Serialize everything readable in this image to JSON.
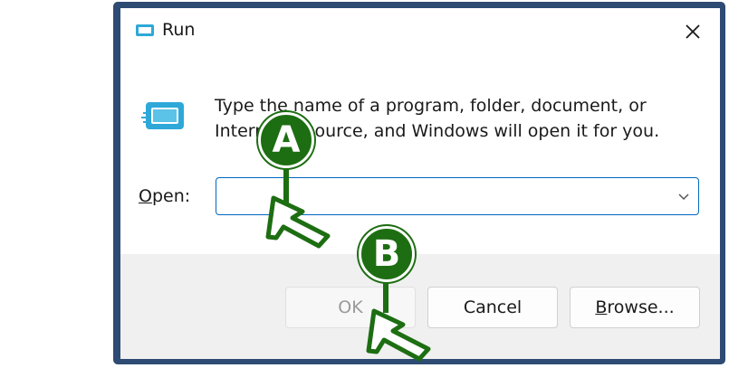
{
  "window": {
    "title": "Run"
  },
  "description": {
    "line1": "Type the name of a program, folder, document, or",
    "line2": "Internet resource, and Windows will open it for you."
  },
  "open_field": {
    "label_prefix": "O",
    "label_rest": "pen:",
    "value": "",
    "placeholder": ""
  },
  "buttons": {
    "ok": "OK",
    "cancel": "Cancel",
    "browse_prefix": "B",
    "browse_rest": "rowse..."
  },
  "markers": {
    "a": "A",
    "b": "B"
  },
  "colors": {
    "frame": "#2d4b73",
    "accent": "#0067c0",
    "marker_green": "#1d6e12",
    "footer": "#f0f0f0"
  },
  "icons": [
    "run-icon",
    "close-icon",
    "chevron-down-icon",
    "pointer-arrow-icon"
  ]
}
